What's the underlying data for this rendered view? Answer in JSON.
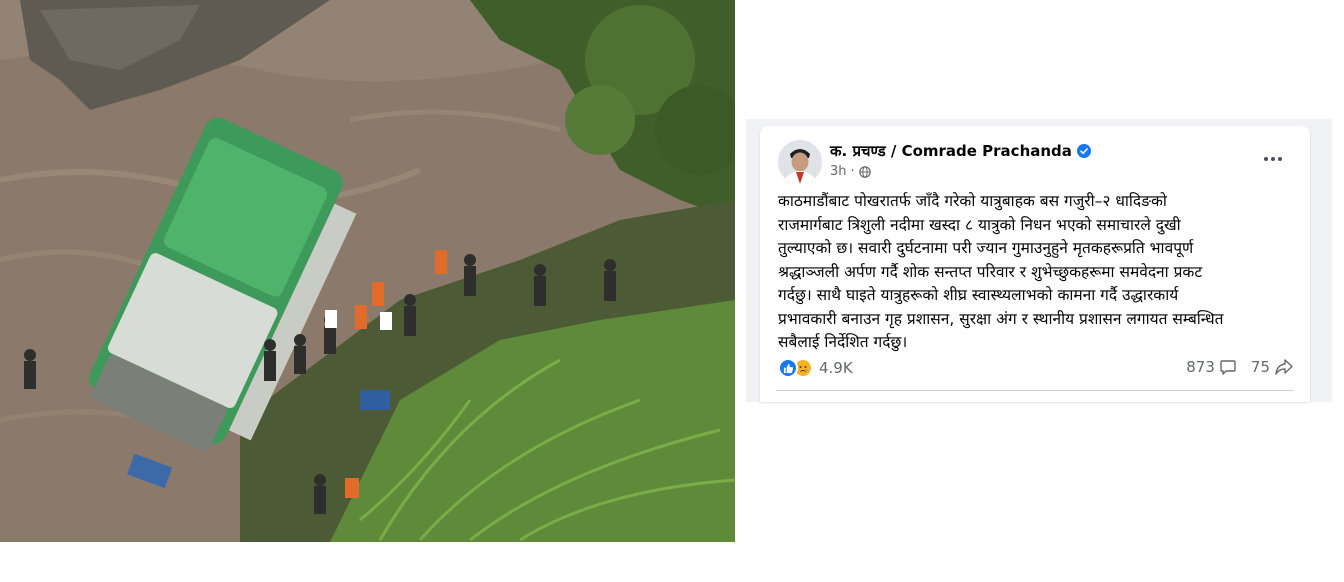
{
  "photo": {
    "description_icon": "photo-image"
  },
  "post": {
    "author": "क. प्रचण्ड / Comrade Prachanda",
    "time": "3h",
    "audience_icon": "globe-icon",
    "body": "काठमाडौंबाट पोखरातर्फ जाँदै गरेको यात्रुबाहक बस गजुरी–२ धादिङको\nराजमार्गबाट त्रिशुली नदीमा खस्दा ८ यात्रुको निधन भएको समाचारले दुखी\nतुल्याएको छ। सवारी दुर्घटनामा परी ज्यान गुमाउनुहुने मृतकहरूप्रति भावपूर्ण\nश्रद्धाञ्जली अर्पण गर्दै शोक सन्तप्त परिवार र शुभेच्छुकहरूमा समवेदना प्रकट\nगर्दछु। साथै घाइते यात्रुहरूको शीघ्र स्वास्थ्यलाभको कामना गर्दै उद्धारकार्य\nप्रभावकारी बनाउन गृह प्रशासन, सुरक्षा अंग र स्थानीय प्रशासन लगायत सम्बन्धित\nसबैलाई निर्देशित गर्दछु।",
    "reaction_count": "4.9K",
    "comments": "873",
    "shares": "75"
  },
  "colors": {
    "accent": "#1877f2",
    "muted": "#65676b"
  }
}
